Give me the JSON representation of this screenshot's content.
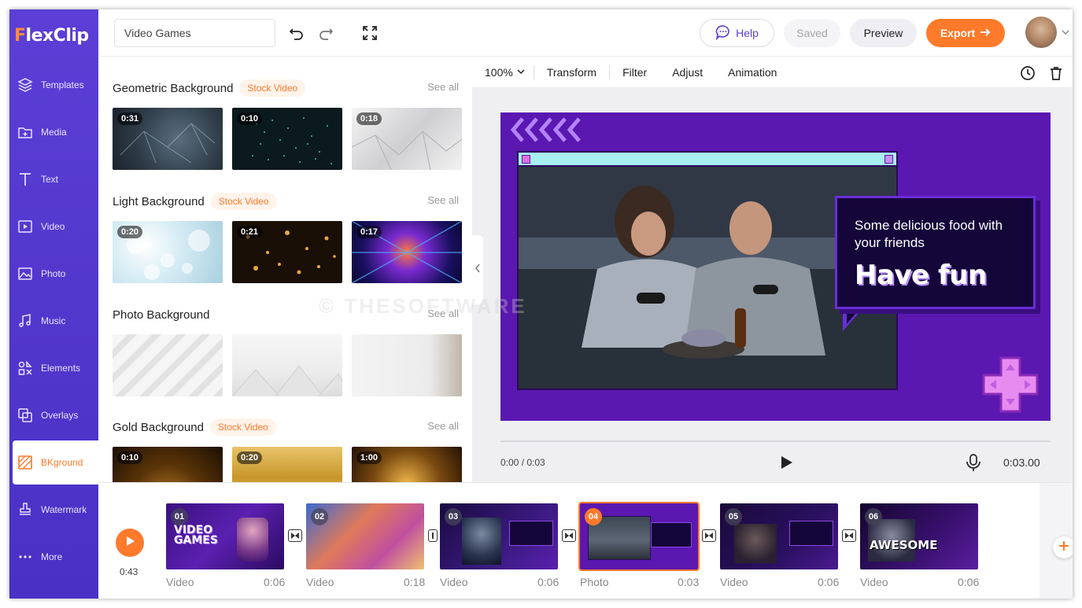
{
  "app": {
    "logo_text": "lexClip",
    "logo_initial": "F"
  },
  "sidebar": {
    "items": [
      {
        "label": "Templates",
        "icon": "layers-icon"
      },
      {
        "label": "Media",
        "icon": "folder-plus-icon"
      },
      {
        "label": "Text",
        "icon": "text-icon"
      },
      {
        "label": "Video",
        "icon": "video-icon"
      },
      {
        "label": "Photo",
        "icon": "image-icon"
      },
      {
        "label": "Music",
        "icon": "music-icon"
      },
      {
        "label": "Elements",
        "icon": "elements-icon"
      },
      {
        "label": "Overlays",
        "icon": "overlays-icon"
      },
      {
        "label": "BKground",
        "icon": "background-icon",
        "active": true
      },
      {
        "label": "Watermark",
        "icon": "stamp-icon"
      },
      {
        "label": "More",
        "icon": "more-icon"
      }
    ]
  },
  "topbar": {
    "project_name": "Video Games",
    "help_label": "Help",
    "saved_label": "Saved",
    "preview_label": "Preview",
    "export_label": "Export"
  },
  "library": {
    "sections": [
      {
        "title": "Geometric Background",
        "tag": "Stock Video",
        "see_all": "See all",
        "thumbs": [
          "0:31",
          "0:10",
          "0:18"
        ]
      },
      {
        "title": "Light Background",
        "tag": "Stock Video",
        "see_all": "See all",
        "thumbs": [
          "0:20",
          "0:21",
          "0:17"
        ]
      },
      {
        "title": "Photo Background",
        "tag": "",
        "see_all": "See all",
        "thumbs": [
          "",
          "",
          ""
        ]
      },
      {
        "title": "Gold Background",
        "tag": "Stock Video",
        "see_all": "See all",
        "thumbs": [
          "0:10",
          "0:20",
          "1:00"
        ]
      }
    ]
  },
  "editor": {
    "zoom": "100%",
    "tools": [
      "Transform",
      "Filter",
      "Adjust",
      "Animation"
    ],
    "canvas": {
      "subtitle": "Some delicious food with your friends",
      "headline": "Have fun"
    },
    "time_current": "0:00 / 0:03",
    "time_total": "0:03.00",
    "watermark": "© THESOFTWARE"
  },
  "timeline": {
    "total_duration": "0:43",
    "clips": [
      {
        "num": "01",
        "type": "Video",
        "length": "0:06"
      },
      {
        "num": "02",
        "type": "Video",
        "length": "0:18"
      },
      {
        "num": "03",
        "type": "Video",
        "length": "0:06"
      },
      {
        "num": "04",
        "type": "Photo",
        "length": "0:03",
        "active": true
      },
      {
        "num": "05",
        "type": "Video",
        "length": "0:06"
      },
      {
        "num": "06",
        "type": "Video",
        "length": "0:06"
      }
    ]
  },
  "colors": {
    "brand_purple": "#5b3fd6",
    "accent_orange": "#ff7a2a",
    "canvas_purple": "#5a18b0"
  }
}
